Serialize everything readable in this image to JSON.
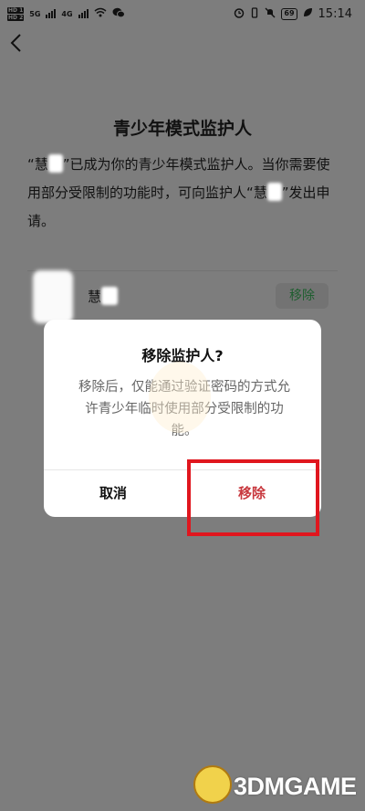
{
  "status_bar": {
    "sim1": "HD 1",
    "sim2": "HD 2",
    "signal1": "5G",
    "signal2": "4G",
    "battery": "69",
    "time": "15:14"
  },
  "page": {
    "title": "青少年模式监护人",
    "desc_part1": "“慧",
    "desc_part2": "”已成为你的青少年模式监护人。当你需要使用部分受限制的功能时，可向监护人“慧",
    "desc_part3": "”发出申请。"
  },
  "guardian": {
    "name": "慧",
    "remove_label": "移除"
  },
  "dialog": {
    "title": "移除监护人?",
    "message": "移除后，仅能通过验证密码的方式允许青少年临时使用部分受限制的功能。",
    "cancel_label": "取消",
    "confirm_label": "移除"
  },
  "watermark": {
    "text": "3DMGAME"
  },
  "colors": {
    "overlay": "#7d7d7d",
    "confirm": "#c8383e",
    "annotation": "#e0161e",
    "chip_text": "#1e5e2f"
  }
}
